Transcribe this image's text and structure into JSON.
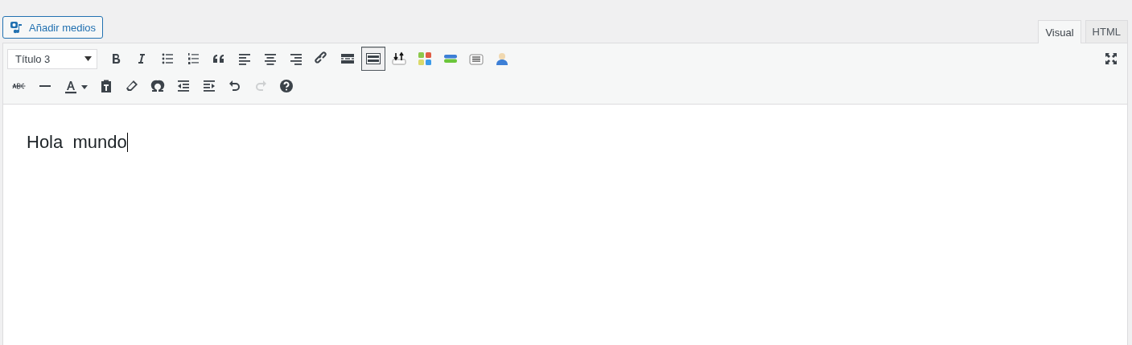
{
  "media_button": {
    "label": "Añadir medios"
  },
  "tabs": [
    {
      "label": "Visual",
      "selected": true
    },
    {
      "label": "HTML",
      "selected": false
    }
  ],
  "toolbar": {
    "format_select": {
      "value": "Título 3"
    },
    "row_1": [
      {
        "kind": "bold",
        "pressed": false,
        "disabled": false
      },
      {
        "kind": "italic",
        "pressed": false,
        "disabled": false
      },
      {
        "kind": "bullets",
        "pressed": false,
        "disabled": false
      },
      {
        "kind": "numbers",
        "pressed": false,
        "disabled": false
      },
      {
        "kind": "quote",
        "pressed": false,
        "disabled": false
      },
      {
        "kind": "alignleft",
        "pressed": false,
        "disabled": false
      },
      {
        "kind": "aligncenter",
        "pressed": false,
        "disabled": false
      },
      {
        "kind": "alignright",
        "pressed": false,
        "disabled": false
      },
      {
        "kind": "link",
        "pressed": false,
        "disabled": false
      },
      {
        "kind": "more",
        "pressed": false,
        "disabled": false
      },
      {
        "kind": "keyboard",
        "pressed": true,
        "disabled": false
      },
      {
        "kind": "updown",
        "pressed": false,
        "disabled": false
      },
      {
        "kind": "grid",
        "pressed": false,
        "disabled": false
      },
      {
        "kind": "bars",
        "pressed": false,
        "disabled": false
      },
      {
        "kind": "note",
        "pressed": false,
        "disabled": false
      },
      {
        "kind": "user",
        "pressed": false,
        "disabled": false
      }
    ],
    "row_2": [
      {
        "kind": "strike",
        "pressed": false,
        "disabled": false
      },
      {
        "kind": "hr",
        "pressed": false,
        "disabled": false
      },
      {
        "kind": "color",
        "pressed": false,
        "disabled": false
      },
      {
        "kind": "paste",
        "pressed": false,
        "disabled": false
      },
      {
        "kind": "eraser",
        "pressed": false,
        "disabled": false
      },
      {
        "kind": "omega",
        "pressed": false,
        "disabled": false
      },
      {
        "kind": "outdent",
        "pressed": false,
        "disabled": false
      },
      {
        "kind": "indent",
        "pressed": false,
        "disabled": false
      },
      {
        "kind": "undo",
        "pressed": false,
        "disabled": false
      },
      {
        "kind": "redo",
        "pressed": false,
        "disabled": true
      },
      {
        "kind": "help",
        "pressed": false,
        "disabled": false
      }
    ]
  },
  "content": {
    "text": "Hola  mundo"
  }
}
